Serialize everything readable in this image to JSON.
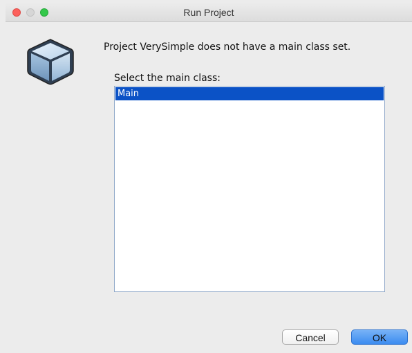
{
  "window": {
    "title": "Run Project"
  },
  "dialog": {
    "message": "Project VerySimple does not have a main class set.",
    "select_label": "Select the main class:",
    "classes": [
      {
        "label": "Main",
        "selected": true
      }
    ]
  },
  "buttons": {
    "cancel": "Cancel",
    "ok": "OK"
  },
  "icons": {
    "app": "netbeans-cube-icon"
  },
  "colors": {
    "selection": "#0b52c6",
    "ok_button": "#3b8cf0"
  }
}
